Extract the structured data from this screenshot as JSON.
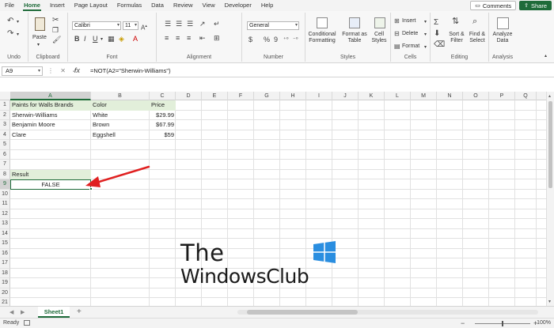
{
  "menu": {
    "tabs": [
      "File",
      "Home",
      "Insert",
      "Page Layout",
      "Formulas",
      "Data",
      "Review",
      "View",
      "Developer",
      "Help"
    ],
    "active": "Home",
    "comments_label": "Comments",
    "share_label": "Share"
  },
  "ribbon": {
    "groups": {
      "undo": "Undo",
      "clipboard": "Clipboard",
      "font": "Font",
      "alignment": "Alignment",
      "number": "Number",
      "styles": "Styles",
      "cells": "Cells",
      "editing": "Editing",
      "analysis": "Analysis"
    },
    "paste_label": "Paste",
    "font_name": "Calibri",
    "font_size": "11",
    "number_format": "General",
    "currency_symbol": "$",
    "percent_symbol": "%",
    "comma_symbol": "9",
    "conditional_formatting": "Conditional Formatting",
    "format_as_table": "Format as Table",
    "cell_styles": "Cell Styles",
    "insert_label": "Insert",
    "delete_label": "Delete",
    "format_label": "Format",
    "sort_filter": "Sort & Filter",
    "find_select": "Find & Select",
    "analyze_data": "Analyze Data"
  },
  "formula_bar": {
    "name_box": "A9",
    "fx": "fx",
    "formula": "=NOT(A2=\"Sherwin-Williams\")"
  },
  "grid": {
    "columns": [
      "A",
      "B",
      "C",
      "D",
      "E",
      "F",
      "G",
      "H",
      "I",
      "J",
      "K",
      "L",
      "M",
      "N",
      "O",
      "P",
      "Q"
    ],
    "rows": [
      "1",
      "2",
      "3",
      "4",
      "5",
      "6",
      "7",
      "8",
      "9",
      "10",
      "11",
      "12",
      "13",
      "14",
      "15",
      "16",
      "17",
      "18",
      "19",
      "20",
      "21"
    ],
    "selected_column": "A",
    "selected_row": "9",
    "cells": {
      "A1": "Paints for Walls Brands",
      "B1": "Color",
      "C1": "Price",
      "A2": "Sherwin-Williams",
      "B2": "White",
      "C2": "$29.99",
      "A3": "Benjamin Moore",
      "B3": "Brown",
      "C3": "$67.99",
      "A4": "Clare",
      "B4": "Eggshell",
      "C4": "$59",
      "A8": "Result",
      "A9": "FALSE"
    }
  },
  "sheets": {
    "active": "Sheet1",
    "add": "+"
  },
  "status": {
    "ready": "Ready",
    "zoom": "100%"
  },
  "watermark": {
    "line1": "The",
    "line2": "WindowsClub"
  },
  "colors": {
    "accent": "#1f6b3a",
    "header_fill": "#e2efda",
    "arrow": "#e02020"
  }
}
